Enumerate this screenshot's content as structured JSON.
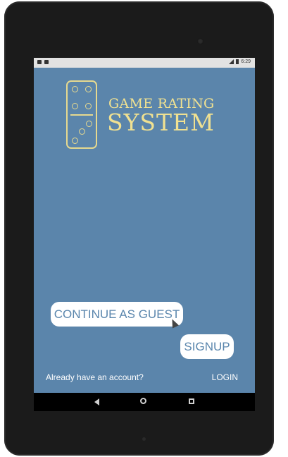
{
  "app": {
    "title_line1": "GAME RATING",
    "title_line2": "SYSTEM"
  },
  "status_bar": {
    "time": "6:29"
  },
  "buttons": {
    "continue_guest": "CONTINUE AS GUEST",
    "signup": "SIGNUP"
  },
  "footer": {
    "prompt": "Already have an account?",
    "login": "LOGIN"
  },
  "navigation": {
    "back_icon": "back-triangle-icon",
    "home_icon": "home-circle-icon",
    "recents_icon": "recents-square-icon"
  },
  "colors": {
    "screen_bg": "#5b85ab",
    "logo_gold": "#f0e191",
    "button_bg": "#ffffff",
    "button_text": "#5a86ad"
  }
}
